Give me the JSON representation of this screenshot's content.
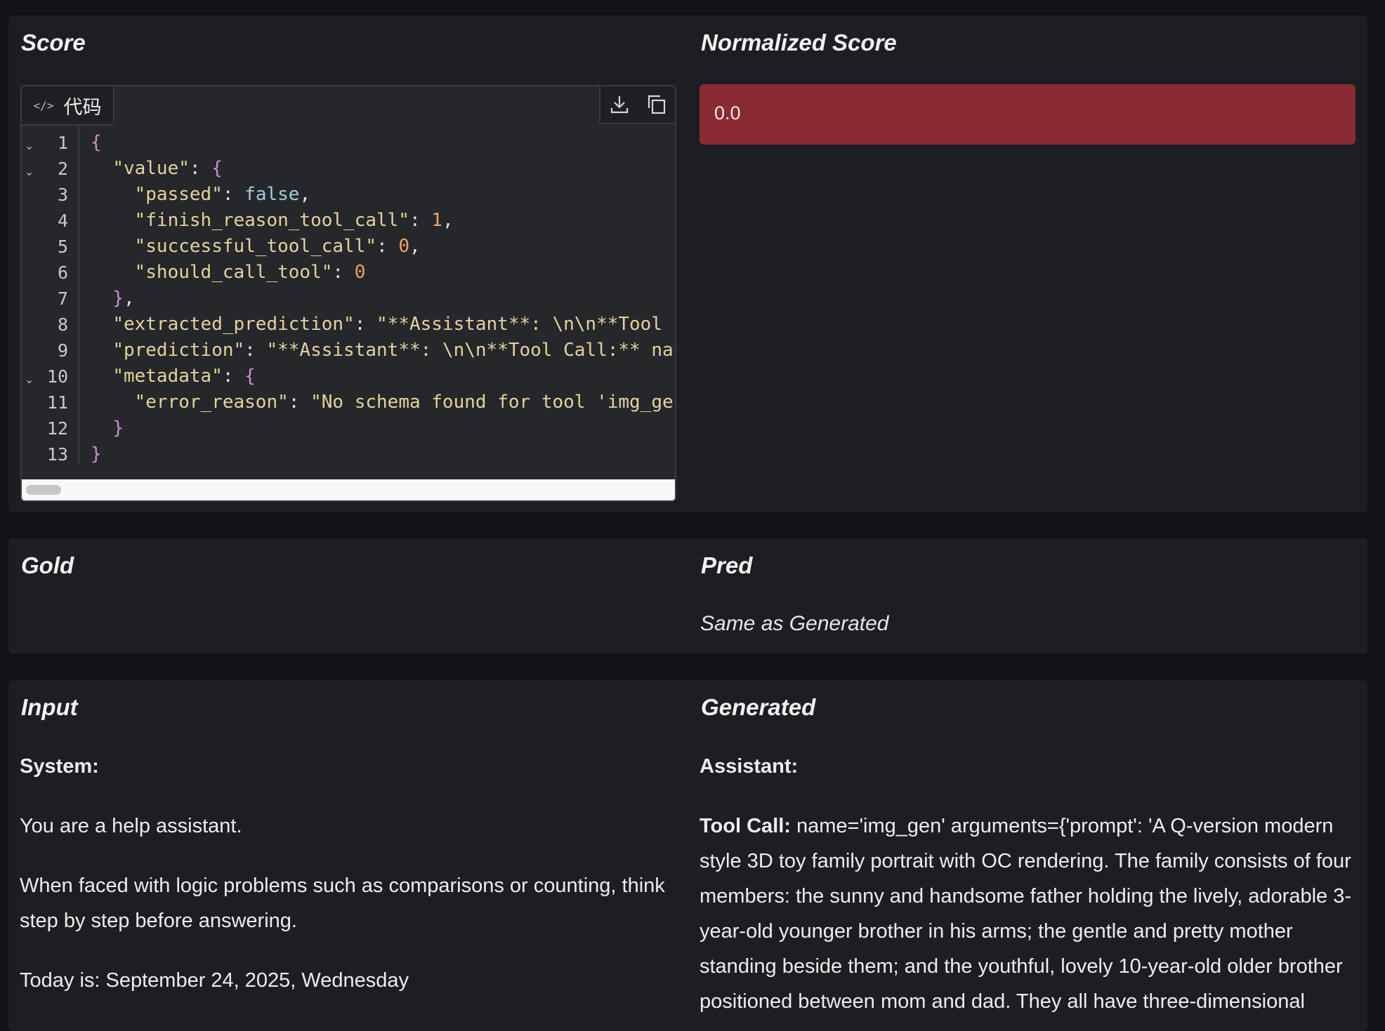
{
  "score": {
    "title": "Score",
    "code_tab_label": "代码",
    "code_lines": [
      [
        {
          "t": "{",
          "c": "b"
        }
      ],
      [
        {
          "t": "  ",
          "c": "p"
        },
        {
          "t": "\"value\"",
          "c": "s"
        },
        {
          "t": ": ",
          "c": "p"
        },
        {
          "t": "{",
          "c": "b"
        }
      ],
      [
        {
          "t": "    ",
          "c": "p"
        },
        {
          "t": "\"passed\"",
          "c": "s"
        },
        {
          "t": ": ",
          "c": "p"
        },
        {
          "t": "false",
          "c": "k"
        },
        {
          "t": ",",
          "c": "p"
        }
      ],
      [
        {
          "t": "    ",
          "c": "p"
        },
        {
          "t": "\"finish_reason_tool_call\"",
          "c": "s"
        },
        {
          "t": ": ",
          "c": "p"
        },
        {
          "t": "1",
          "c": "n"
        },
        {
          "t": ",",
          "c": "p"
        }
      ],
      [
        {
          "t": "    ",
          "c": "p"
        },
        {
          "t": "\"successful_tool_call\"",
          "c": "s"
        },
        {
          "t": ": ",
          "c": "p"
        },
        {
          "t": "0",
          "c": "n"
        },
        {
          "t": ",",
          "c": "p"
        }
      ],
      [
        {
          "t": "    ",
          "c": "p"
        },
        {
          "t": "\"should_call_tool\"",
          "c": "s"
        },
        {
          "t": ": ",
          "c": "p"
        },
        {
          "t": "0",
          "c": "n"
        }
      ],
      [
        {
          "t": "  ",
          "c": "p"
        },
        {
          "t": "}",
          "c": "b"
        },
        {
          "t": ",",
          "c": "p"
        }
      ],
      [
        {
          "t": "  ",
          "c": "p"
        },
        {
          "t": "\"extracted_prediction\"",
          "c": "s"
        },
        {
          "t": ": ",
          "c": "p"
        },
        {
          "t": "\"**Assistant**: \\n\\n**Tool",
          "c": "s"
        }
      ],
      [
        {
          "t": "  ",
          "c": "p"
        },
        {
          "t": "\"prediction\"",
          "c": "s"
        },
        {
          "t": ": ",
          "c": "p"
        },
        {
          "t": "\"**Assistant**: \\n\\n**Tool Call:** na",
          "c": "s"
        }
      ],
      [
        {
          "t": "  ",
          "c": "p"
        },
        {
          "t": "\"metadata\"",
          "c": "s"
        },
        {
          "t": ": ",
          "c": "p"
        },
        {
          "t": "{",
          "c": "b"
        }
      ],
      [
        {
          "t": "    ",
          "c": "p"
        },
        {
          "t": "\"error_reason\"",
          "c": "s"
        },
        {
          "t": ": ",
          "c": "p"
        },
        {
          "t": "\"No schema found for tool 'img_ge",
          "c": "s"
        }
      ],
      [
        {
          "t": "  ",
          "c": "p"
        },
        {
          "t": "}",
          "c": "b"
        }
      ],
      [
        {
          "t": "}",
          "c": "b"
        }
      ]
    ],
    "line_numbers": [
      "1",
      "2",
      "3",
      "4",
      "5",
      "6",
      "7",
      "8",
      "9",
      "10",
      "11",
      "12",
      "13"
    ],
    "foldable_lines": [
      1,
      2,
      10
    ]
  },
  "normalized_score": {
    "title": "Normalized Score",
    "value": "0.0",
    "status_color": "#8a2a33"
  },
  "gold": {
    "title": "Gold"
  },
  "pred": {
    "title": "Pred",
    "value": "Same as Generated"
  },
  "input": {
    "title": "Input",
    "role": "System:",
    "paragraphs": [
      [
        "You are a help assistant."
      ],
      [
        "When faced with logic problems such as comparisons or counting, think",
        "step by step before answering."
      ],
      [
        "Today is: September 24, 2025, Wednesday"
      ]
    ]
  },
  "generated": {
    "title": "Generated",
    "role": "Assistant:",
    "tool_call_label": "Tool Call:",
    "tool_call_lines": [
      "name='img_gen' arguments={'prompt': 'A Q-version modern",
      "style 3D toy family portrait with OC rendering. The family consists of four",
      "members: the sunny and handsome father holding the lively, adorable 3-",
      "year-old younger brother in his arms; the gentle and pretty mother",
      "standing beside them; and the youthful, lovely 10-year-old older brother",
      "positioned between mom and dad. They all have three-dimensional"
    ]
  }
}
